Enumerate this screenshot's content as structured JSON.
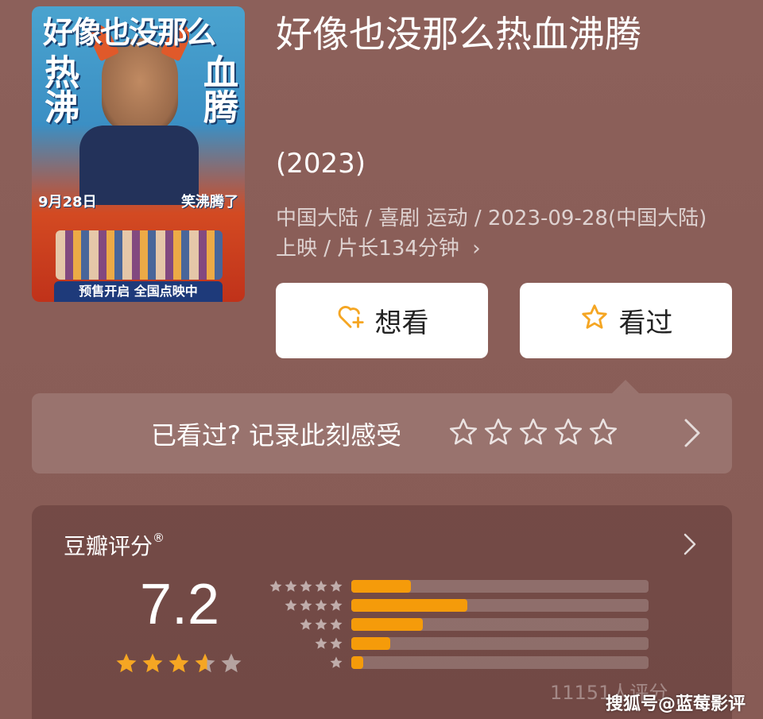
{
  "movie": {
    "title": "好像也没那么热血沸腾",
    "year": "(2023)",
    "meta": "中国大陆 / 喜剧 运动 / 2023-09-28(中国大陆)上映 / 片长134分钟",
    "meta_chevron": "›",
    "poster": {
      "top_text": "好像也没那么",
      "left_text": "热沸",
      "right_text": "血腾",
      "date": "9月28日",
      "tag": "笑沸腾了",
      "banner": "预售开启 全国点映中"
    }
  },
  "actions": {
    "want_label": "想看",
    "seen_label": "看过",
    "want_icon": "heart-plus-icon",
    "seen_icon": "star-outline-icon",
    "accent": "#f5a623"
  },
  "record": {
    "prompt": "已看过? 记录此刻感受",
    "stars": 5
  },
  "rating": {
    "title": "豆瓣评分",
    "reg_mark": "®",
    "score": "7.2",
    "stars_value": 3.6,
    "distribution": [
      {
        "stars": 5,
        "fraction": 0.2
      },
      {
        "stars": 4,
        "fraction": 0.39
      },
      {
        "stars": 3,
        "fraction": 0.24
      },
      {
        "stars": 2,
        "fraction": 0.13
      },
      {
        "stars": 1,
        "fraction": 0.04
      }
    ],
    "count_text": "11151人评分",
    "bar_color": "#f59b0a"
  },
  "watermark": "搜狐号@蓝莓影评"
}
